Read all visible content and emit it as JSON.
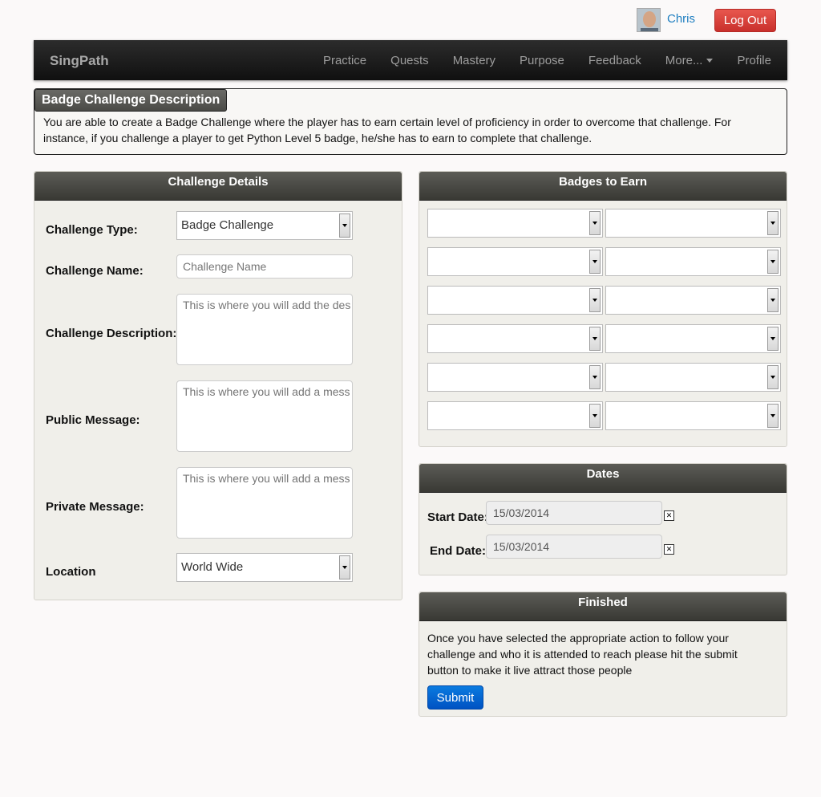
{
  "user": {
    "name": "Chris",
    "logout_label": "Log Out"
  },
  "navbar": {
    "brand": "SingPath",
    "items": [
      "Practice",
      "Quests",
      "Mastery",
      "Purpose",
      "Feedback",
      "More...",
      "Profile"
    ]
  },
  "description": {
    "title": "Badge Challenge Description",
    "text": "You are able to create a Badge Challenge where the player has to earn certain level of proficiency in order to overcome that challenge. For instance, if you challenge a player to get Python Level 5 badge, he/she has to earn to complete that challenge."
  },
  "challenge_details": {
    "heading": "Challenge Details",
    "type_label": "Challenge Type:",
    "type_value": "Badge Challenge",
    "name_label": "Challenge Name:",
    "name_placeholder": "Challenge Name",
    "desc_label": "Challenge Description:",
    "desc_placeholder": "This is where you will add the des",
    "public_label": "Public Message:",
    "public_placeholder": "This is where you will add a mess",
    "private_label": "Private Message:",
    "private_placeholder": "This is where you will add a mess",
    "location_label": "Location",
    "location_value": "World Wide"
  },
  "badges": {
    "heading": "Badges to Earn",
    "rows": 6
  },
  "dates": {
    "heading": "Dates",
    "start_label": "Start Date:",
    "start_value": "15/03/2014",
    "end_label": "End Date:",
    "end_value": "15/03/2014"
  },
  "finished": {
    "heading": "Finished",
    "text": "Once you have selected the appropriate action to follow your challenge and who it is attended to reach please hit the submit button to make it live attract those people",
    "submit_label": "Submit"
  }
}
